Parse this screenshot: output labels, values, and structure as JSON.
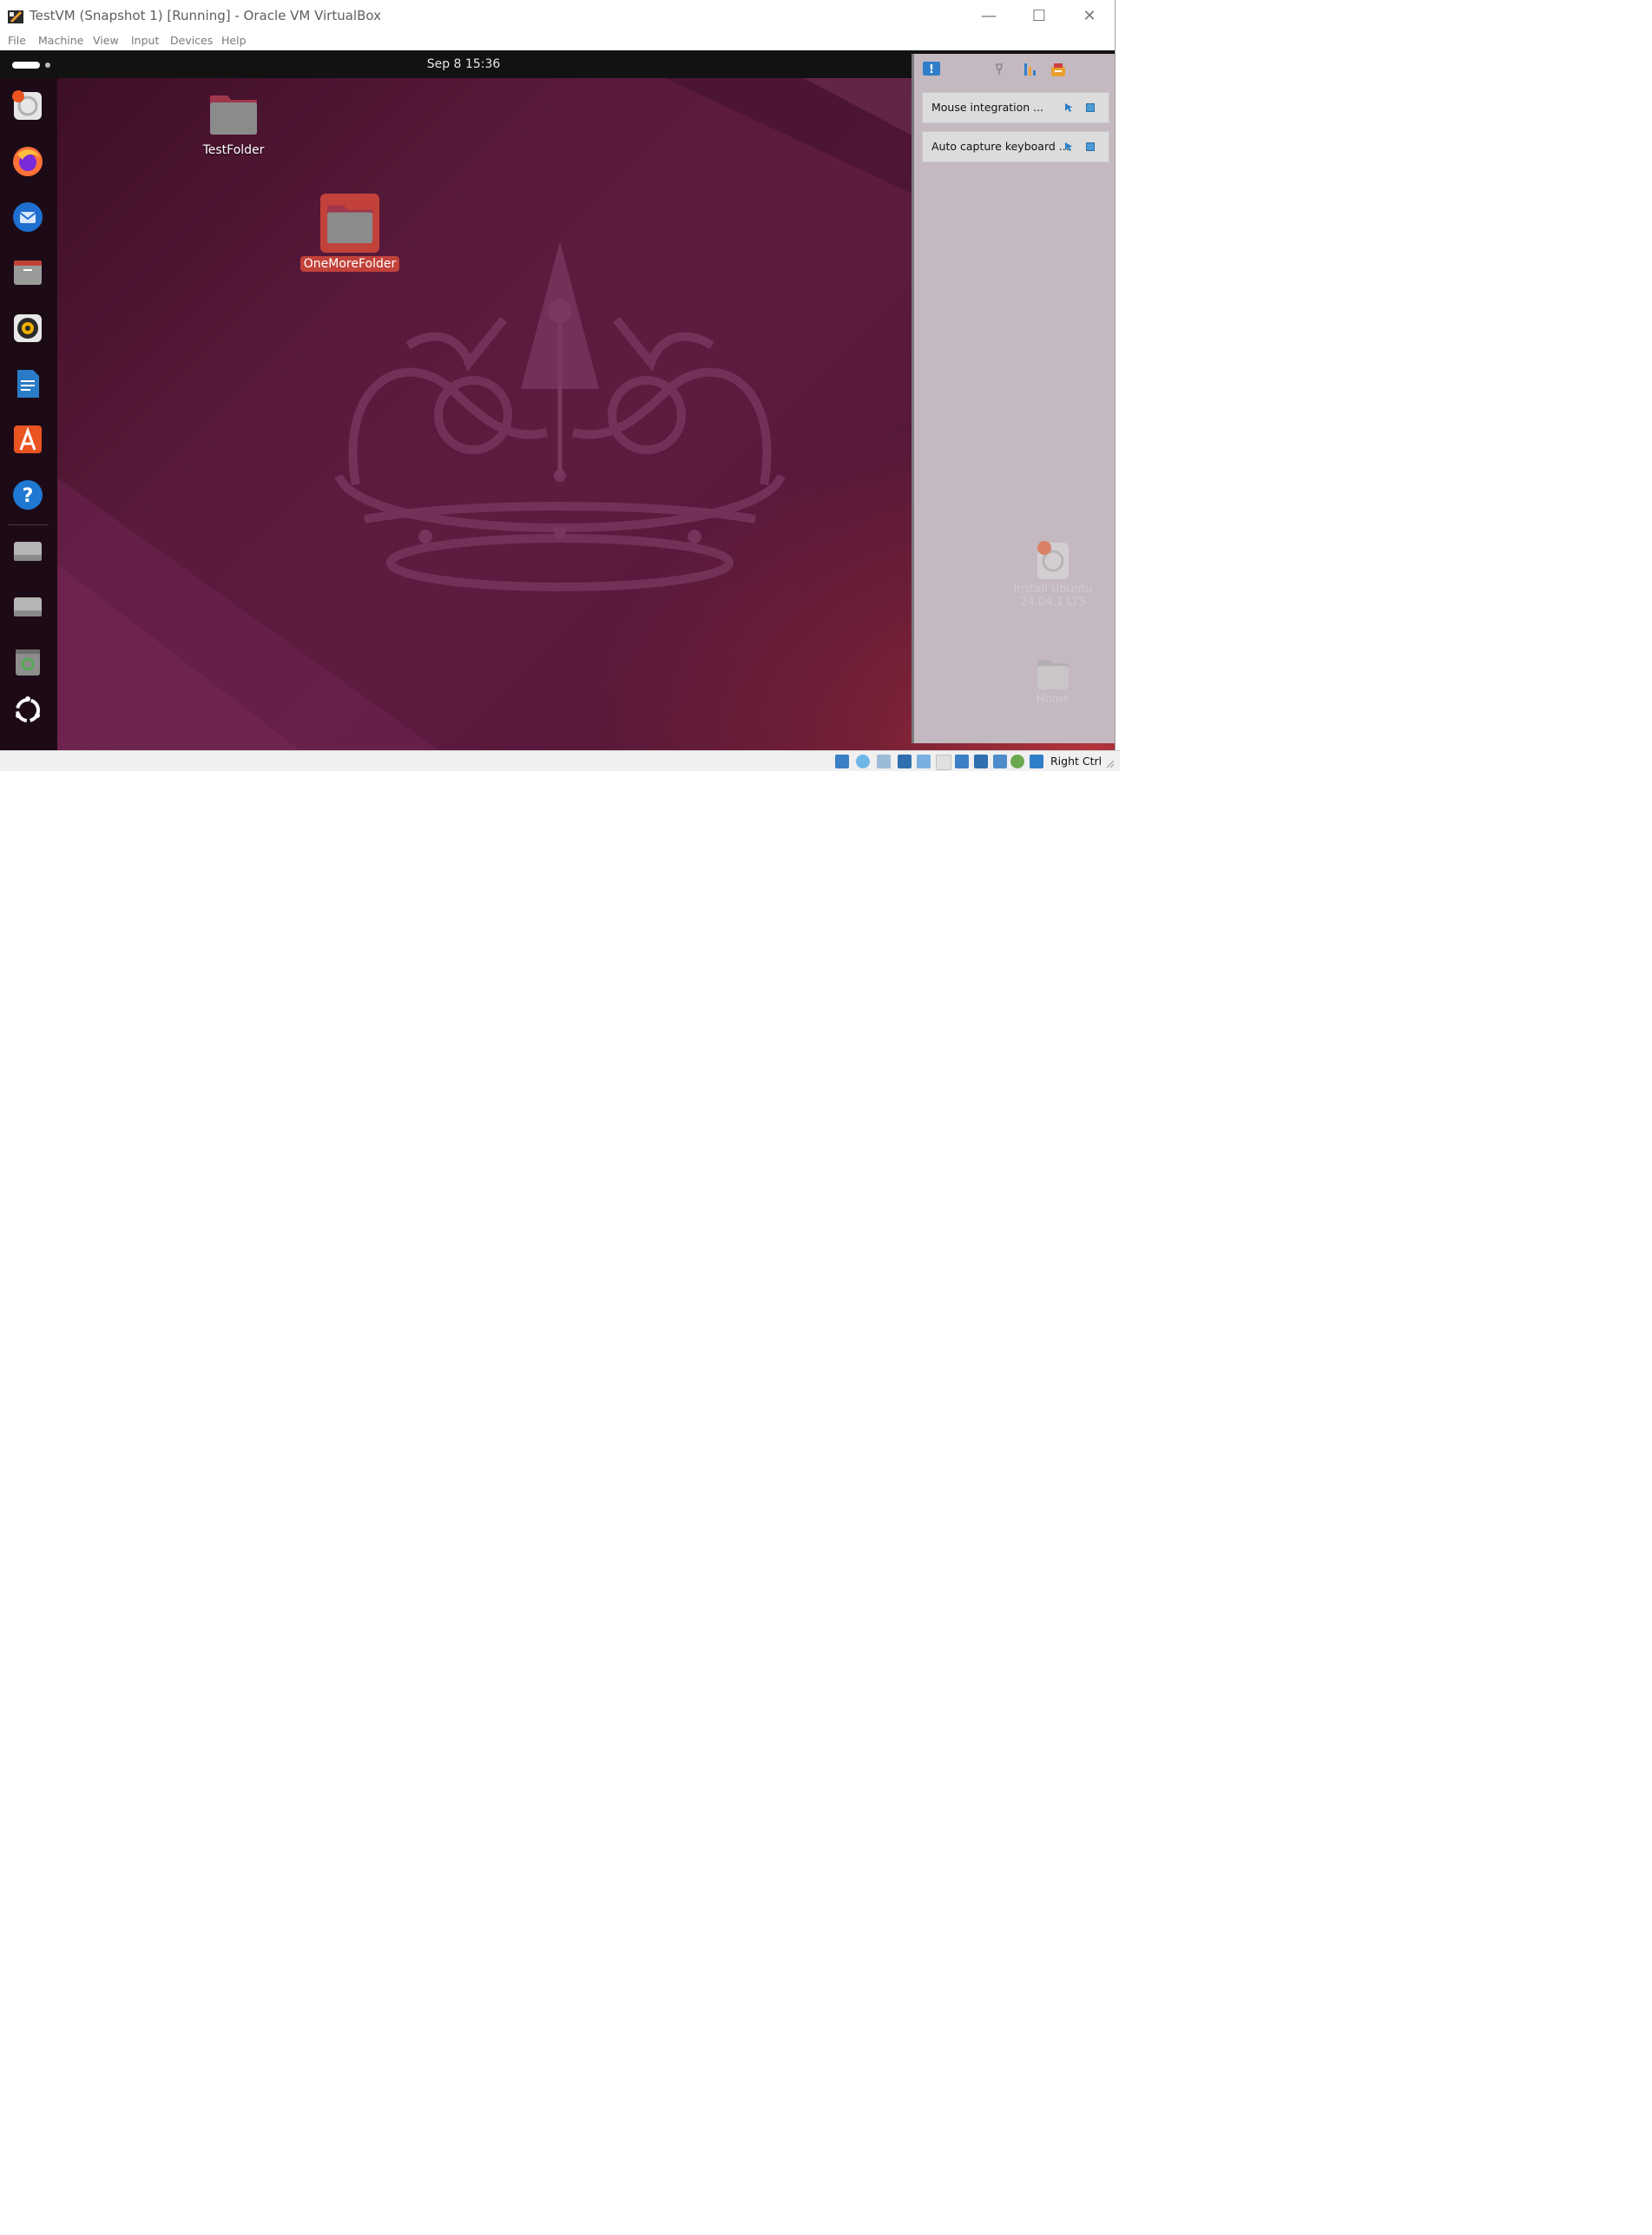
{
  "window": {
    "title": "TestVM (Snapshot 1) [Running] - Oracle VM VirtualBox",
    "controls": {
      "minimize": "—",
      "maximize": "☐",
      "close": "✕"
    }
  },
  "menubar": {
    "items": [
      "File",
      "Machine",
      "View",
      "Input",
      "Devices",
      "Help"
    ]
  },
  "guest": {
    "topbar": {
      "clock": "Sep 8  15:36"
    },
    "dock": {
      "apps": [
        "installer-icon",
        "firefox-icon",
        "thunderbird-icon",
        "files-icon",
        "rhythmbox-icon",
        "writer-icon",
        "app-center-icon",
        "help-icon",
        "drive-icon",
        "drive-icon",
        "trash-icon",
        "show-apps-icon"
      ]
    },
    "desktop": {
      "icons": [
        {
          "label": "TestFolder"
        },
        {
          "label": "OneMoreFolder"
        }
      ],
      "ghost_icons": [
        {
          "label_line1": "Install Ubuntu",
          "label_line2": "24.04.1 LTS"
        },
        {
          "label_line1": "Home"
        }
      ]
    }
  },
  "notifications": [
    {
      "text": "Mouse integration ..."
    },
    {
      "text": "Auto capture keyboard ..."
    }
  ],
  "statusbar": {
    "host_key": "Right Ctrl"
  },
  "colors": {
    "accent": "#c2423a",
    "wallpaper": "#5a1a3c",
    "topbar": "#121212"
  }
}
